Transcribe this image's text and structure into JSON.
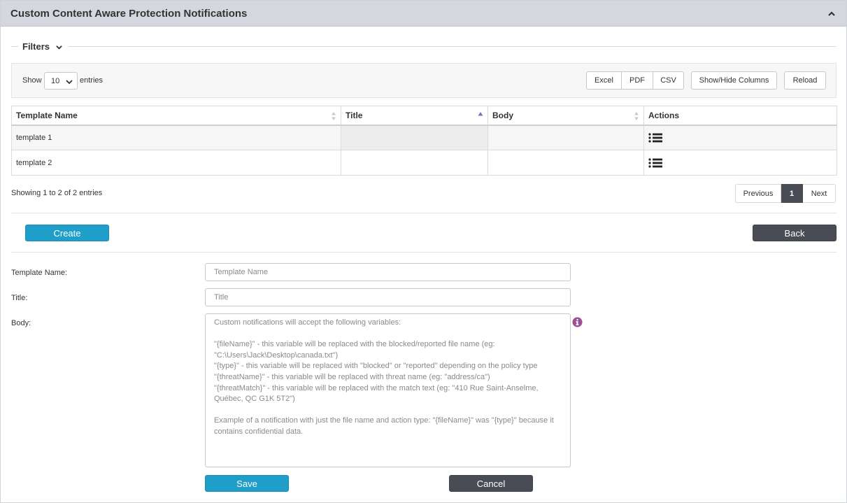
{
  "header": {
    "title": "Custom Content Aware Protection Notifications"
  },
  "filters": {
    "label": "Filters"
  },
  "toolbar": {
    "show_label": "Show",
    "entries_value": "10",
    "entries_label": "entries",
    "export_buttons": [
      "Excel",
      "PDF",
      "CSV"
    ],
    "show_hide_label": "Show/Hide Columns",
    "reload_label": "Reload"
  },
  "table": {
    "columns": [
      "Template Name",
      "Title",
      "Body",
      "Actions"
    ],
    "sorted_column": "Title",
    "rows": [
      {
        "template_name": "template 1",
        "title": "",
        "body": ""
      },
      {
        "template_name": "template 2",
        "title": "",
        "body": ""
      }
    ]
  },
  "pagination": {
    "info": "Showing 1 to 2 of 2 entries",
    "previous": "Previous",
    "current": "1",
    "next": "Next"
  },
  "actions": {
    "create_label": "Create",
    "back_label": "Back"
  },
  "form": {
    "template_name_label": "Template Name:",
    "template_name_placeholder": "Template Name",
    "title_label": "Title:",
    "title_placeholder": "Title",
    "body_label": "Body:",
    "body_placeholder": "Custom notifications will accept the following variables:\n\n\"{fileName}\" - this variable will be replaced with the blocked/reported file name (eg: \"C:\\Users\\Jack\\Desktop\\canada.txt\")\n\"{type}\" - this variable will be replaced with \"blocked\" or \"reported\" depending on the policy type\n\"{threatName}\" - this variable will be replaced with threat name (eg: \"address/ca\")\n\"{threatMatch}\" - this variable will be replaced with the match text (eg: \"410 Rue Saint-Anselme, Québec, QC G1K 5T2\")\n\nExample of a notification with just the file name and action type: \"{fileName}\" was \"{type}\" because it contains confidential data.",
    "save_label": "Save",
    "cancel_label": "Cancel"
  },
  "colors": {
    "accent": "#1f9ec9",
    "dark_button": "#4a4c55",
    "header_bg": "#d4d8de",
    "info_icon": "#9b4f96"
  }
}
